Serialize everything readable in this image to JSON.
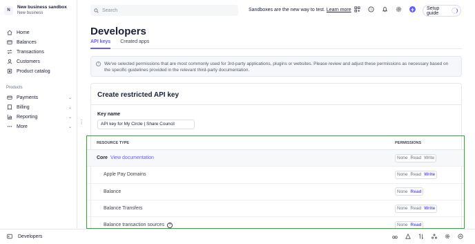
{
  "account": {
    "badge": "N",
    "name": "New business sandbox",
    "subtitle": "New business"
  },
  "sidebar": {
    "items": [
      {
        "label": "Home",
        "icon": "home-icon"
      },
      {
        "label": "Balances",
        "icon": "balances-icon"
      },
      {
        "label": "Transactions",
        "icon": "transactions-icon"
      },
      {
        "label": "Customers",
        "icon": "customers-icon"
      },
      {
        "label": "Product catalog",
        "icon": "product-catalog-icon"
      }
    ],
    "products_label": "Products",
    "products": [
      {
        "label": "Payments",
        "icon": "payments-icon"
      },
      {
        "label": "Billing",
        "icon": "billing-icon"
      },
      {
        "label": "Reporting",
        "icon": "reporting-icon"
      },
      {
        "label": "More",
        "icon": "more-icon"
      }
    ]
  },
  "topbar": {
    "search_placeholder": "Search",
    "sandbox_message": "Sandboxes are the new way to test.",
    "learn_more": "Learn more",
    "setup_guide": "Setup guide",
    "plus": "+"
  },
  "page": {
    "title": "Developers",
    "tabs": [
      "API keys",
      "Created apps"
    ],
    "info_text": "We've selected permissions that are most commonly used for 3rd-party applications, plugins or websites. Please review and adjust these permissions as necessary based on the specific guidelines provided in the relevant third-party documentation."
  },
  "form": {
    "card_title": "Create restricted API key",
    "key_label": "Key name",
    "key_value": "API key for My Circle | Share Council"
  },
  "table": {
    "col_resource": "RESOURCE TYPE",
    "col_permissions": "PERMISSIONS",
    "core": {
      "label": "Core",
      "link": "View documentation",
      "options": [
        "None",
        "Read",
        "Write"
      ]
    },
    "rows": [
      {
        "label": "Apple Pay Domains",
        "options": [
          "None",
          "Read",
          "Write"
        ],
        "selected": "Write"
      },
      {
        "label": "Balance",
        "options": [
          "None",
          "Read"
        ],
        "selected": "Read"
      },
      {
        "label": "Balance Transfers",
        "options": [
          "None",
          "Read",
          "Write"
        ],
        "selected": "Write"
      },
      {
        "label": "Balance transaction sources",
        "options": [
          "None",
          "Read"
        ],
        "selected": "Read",
        "help": "?"
      }
    ]
  },
  "bottombar": {
    "label": "Developers"
  },
  "colors": {
    "accent": "#635bff",
    "highlight_border": "#2ea82b"
  }
}
